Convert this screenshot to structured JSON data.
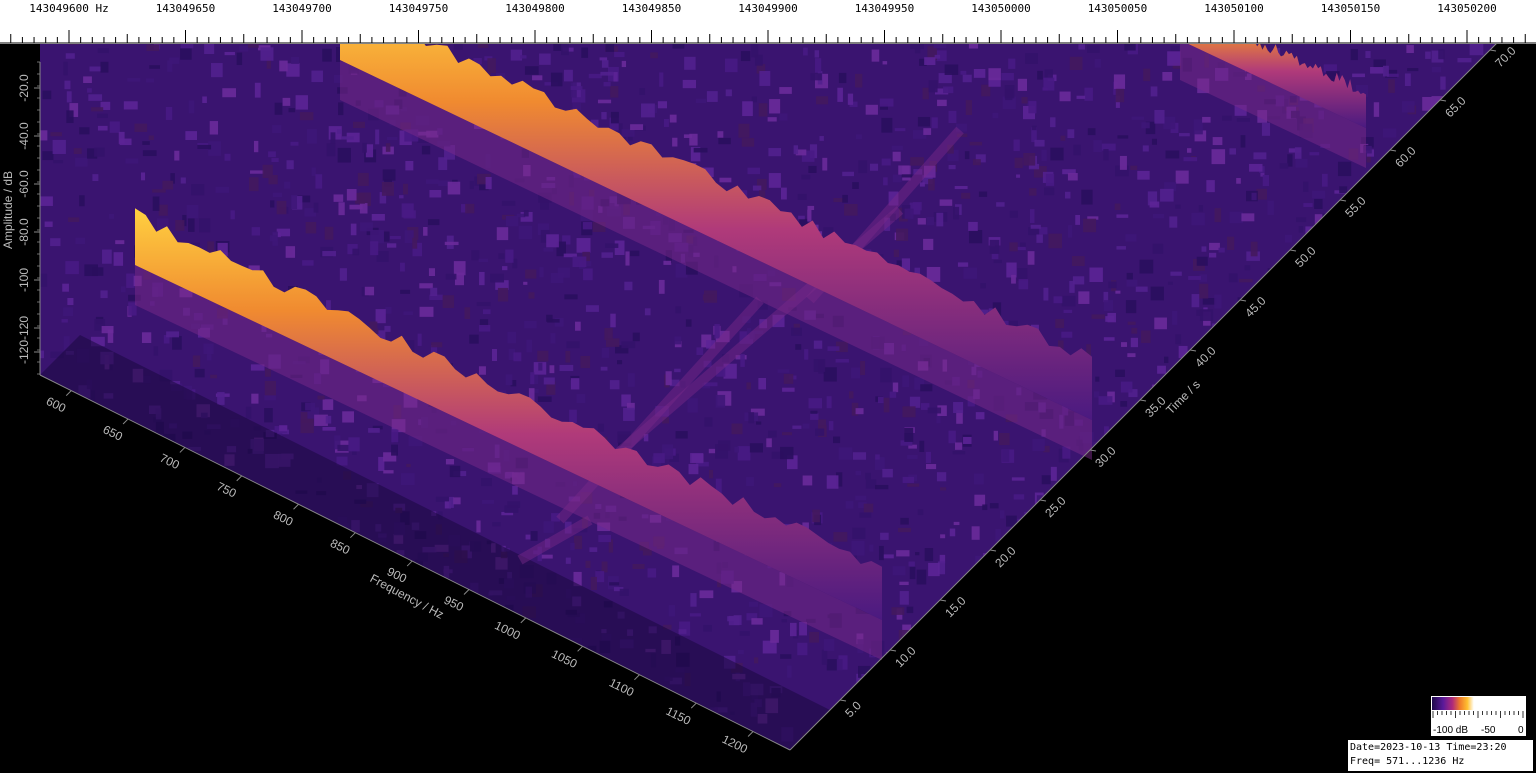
{
  "top_scale": {
    "unit": "Hz",
    "labels": [
      "143049600",
      "143049650",
      "143049700",
      "143049750",
      "143049800",
      "143049850",
      "143049900",
      "143049950",
      "143050000",
      "143050050",
      "143050100",
      "143050150",
      "143050200"
    ]
  },
  "chart_data": {
    "type": "heatmap",
    "subtype": "3d-waterfall",
    "freq_axis": {
      "title": "Frequency / Hz",
      "ticks": [
        "600",
        "650",
        "700",
        "750",
        "800",
        "850",
        "900",
        "950",
        "1000",
        "1050",
        "1100",
        "1150",
        "1200"
      ]
    },
    "time_axis": {
      "title": "Time / s",
      "ticks": [
        "5.0",
        "10.0",
        "15.0",
        "20.0",
        "25.0",
        "30.0",
        "35.0",
        "40.0",
        "45.0",
        "50.0",
        "55.0",
        "60.0",
        "65.0",
        "70.0"
      ]
    },
    "amp_axis": {
      "title": "Amplitude / dB",
      "ticks": [
        "-20.0",
        "-40.0",
        "-60.0",
        "-80.0",
        "-100",
        "-120",
        "-120"
      ]
    },
    "colorbar": {
      "labels": [
        "-100 dB",
        "-50",
        "0"
      ],
      "colors": [
        "#1e0a4a",
        "#5a1a9a",
        "#b02a7a",
        "#f07a2a",
        "#ffc030",
        "#ffffff"
      ]
    },
    "signals_hz": [
      {
        "f_start": 715,
        "f_end": 1235,
        "t_start": 0,
        "t_end": 72,
        "level_db": -70
      },
      {
        "f_start": 720,
        "f_end": 1240,
        "t_start": 0,
        "t_end": 72,
        "level_db": -72
      }
    ]
  },
  "info": {
    "line1": "Date=2023-10-13 Time=23:20",
    "line2": "Freq= 571...1236 Hz"
  }
}
